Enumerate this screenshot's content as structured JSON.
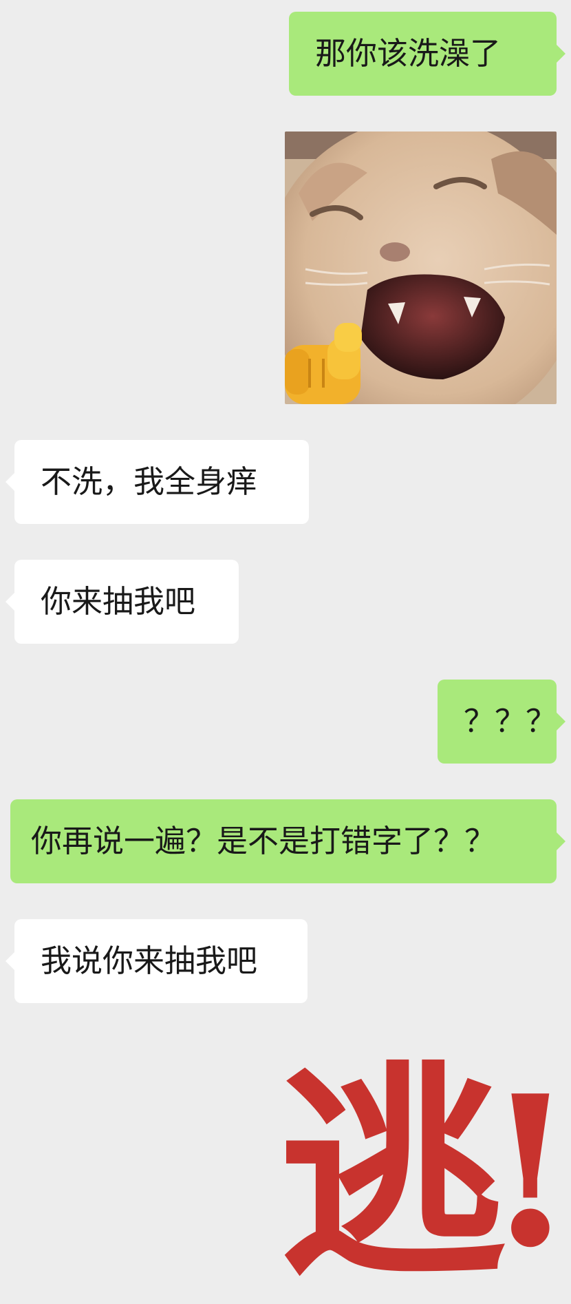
{
  "conversation": {
    "messages": [
      {
        "side": "me",
        "type": "text",
        "text": "那你该洗澡了"
      },
      {
        "side": "me",
        "type": "sticker",
        "sticker": "laughing-cat-pointing-finger-sticker"
      },
      {
        "side": "other",
        "type": "text",
        "text": "不洗，我全身痒"
      },
      {
        "side": "other",
        "type": "text",
        "text": "你来抽我吧"
      },
      {
        "side": "me",
        "type": "text",
        "text": "？？？"
      },
      {
        "side": "me",
        "type": "text",
        "text": "你再说一遍？是不是打错字了？？"
      },
      {
        "side": "other",
        "type": "text",
        "text": "我说你来抽我吧"
      }
    ]
  },
  "caption": {
    "char": "逃",
    "punct": "!",
    "color": "#c8332e"
  },
  "colors": {
    "background": "#ededed",
    "my_bubble": "#a9e97b",
    "their_bubble": "#ffffff",
    "text": "#191919"
  }
}
